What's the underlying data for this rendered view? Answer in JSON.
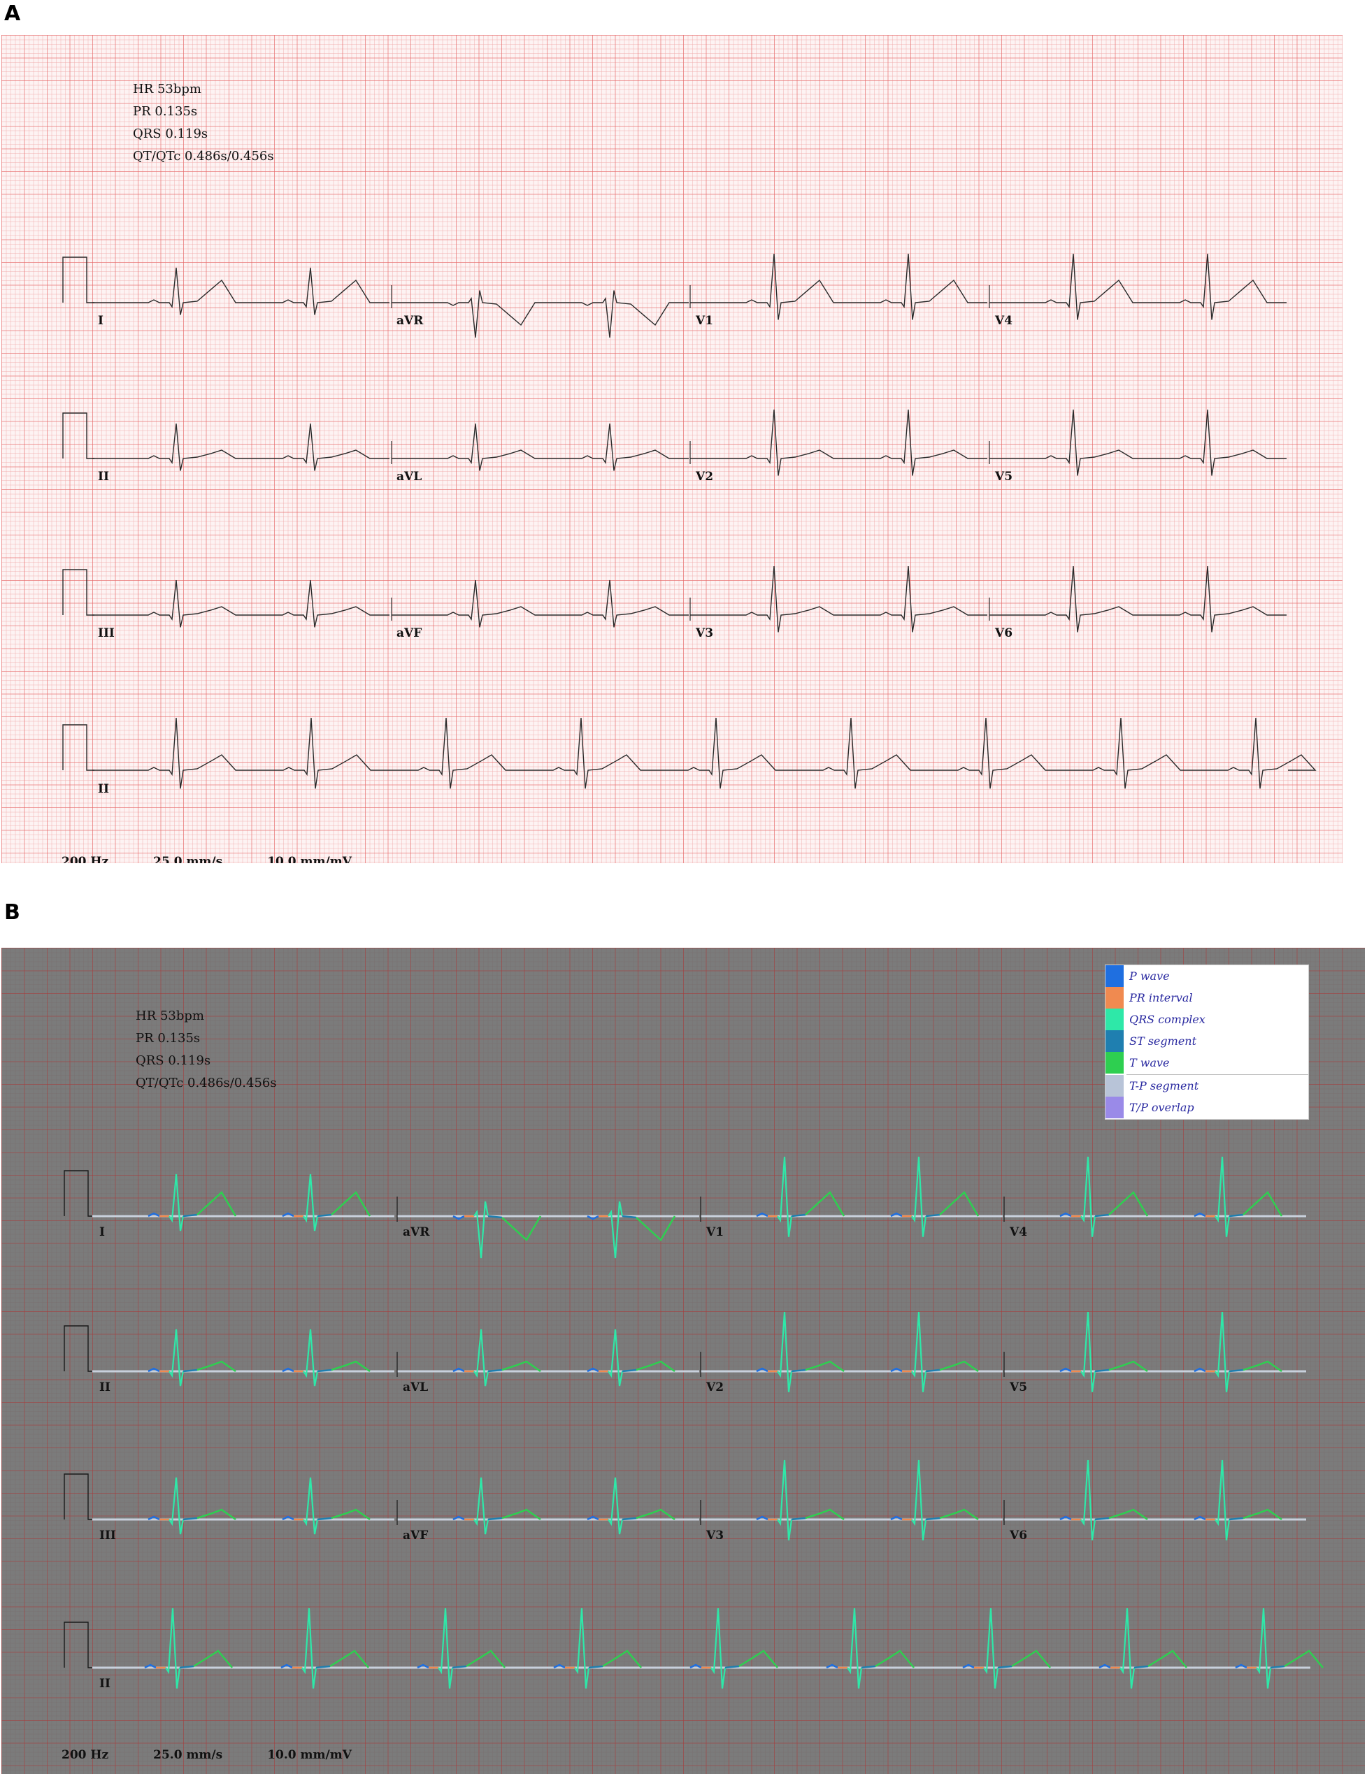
{
  "figure": {
    "panel_a_letter": "A",
    "panel_b_letter": "B"
  },
  "measurements": {
    "hr": "HR 53bpm",
    "pr": "PR 0.135s",
    "qrs": "QRS 0.119s",
    "qt": "QT/QTc 0.486s/0.456s"
  },
  "settings": {
    "sampling": "200 Hz",
    "speed": "25.0 mm/s",
    "gain": "10.0 mm/mV"
  },
  "leads": {
    "row1": [
      "I",
      "aVR",
      "V1",
      "V4"
    ],
    "row2": [
      "II",
      "aVL",
      "V2",
      "V5"
    ],
    "row3": [
      "III",
      "aVF",
      "V3",
      "V6"
    ],
    "rhythm": "II"
  },
  "legend": [
    {
      "label": "P wave",
      "color": "#1f6fe0"
    },
    {
      "label": "PR interval",
      "color": "#f08a50"
    },
    {
      "label": "QRS complex",
      "color": "#2ee8a8"
    },
    {
      "label": "ST segment",
      "color": "#1f7fb0"
    },
    {
      "label": "T wave",
      "color": "#2ecf50"
    },
    {
      "label": "T-P segment",
      "color": "#b8c4d8"
    },
    {
      "label": "T/P overlap",
      "color": "#9a8ae8"
    }
  ],
  "colors": {
    "trace_a": "#2a2a2a",
    "grid_a_major": "#e66464",
    "grid_b_bg": "#7b7b7b"
  }
}
